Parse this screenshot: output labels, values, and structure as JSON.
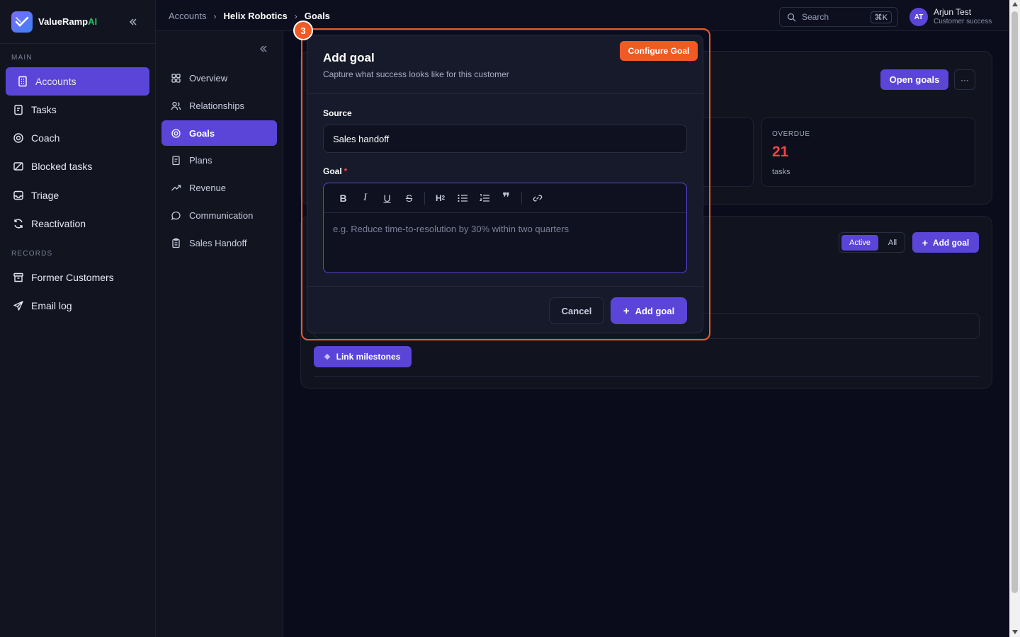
{
  "brand": {
    "name": "ValueRamp",
    "suffix": "AI"
  },
  "sidebar": {
    "main_label": "MAIN",
    "main_items": [
      {
        "label": "Accounts",
        "icon": "building-icon",
        "active": true
      },
      {
        "label": "Tasks",
        "icon": "clipboard-icon"
      },
      {
        "label": "Coach",
        "icon": "target-icon"
      },
      {
        "label": "Blocked tasks",
        "icon": "blocked-icon"
      },
      {
        "label": "Triage",
        "icon": "inbox-icon"
      },
      {
        "label": "Reactivation",
        "icon": "refresh-icon"
      }
    ],
    "records_label": "RECORDS",
    "records_items": [
      {
        "label": "Former Customers",
        "icon": "archive-icon"
      },
      {
        "label": "Email log",
        "icon": "send-icon"
      }
    ]
  },
  "subnav": {
    "items": [
      {
        "label": "Overview",
        "icon": "grid-icon"
      },
      {
        "label": "Relationships",
        "icon": "users-icon"
      },
      {
        "label": "Goals",
        "icon": "target-icon",
        "active": true
      },
      {
        "label": "Plans",
        "icon": "clipboard-icon"
      },
      {
        "label": "Revenue",
        "icon": "trend-up-icon"
      },
      {
        "label": "Communication",
        "icon": "chat-icon"
      },
      {
        "label": "Sales Handoff",
        "icon": "clipboard-list-icon"
      }
    ]
  },
  "breadcrumb": {
    "items": [
      "Accounts",
      "Helix Robotics",
      "Goals"
    ]
  },
  "search": {
    "placeholder": "Search",
    "shortcut": "⌘K"
  },
  "user": {
    "initials": "AT",
    "name": "Arjun Test",
    "role": "Customer success"
  },
  "header_card": {
    "open_goals_label": "Open goals",
    "more_label": "···"
  },
  "overdue": {
    "label": "OVERDUE",
    "value": "21",
    "unit": "tasks"
  },
  "goals_card": {
    "toggle_active": "Active",
    "toggle_all": "All",
    "add_goal_label": "Add goal",
    "link_milestones_label": "Link milestones"
  },
  "modal": {
    "step": "3",
    "configure_label": "Configure Goal",
    "title": "Add goal",
    "subtitle": "Capture what success looks like for this customer",
    "source_label": "Source",
    "source_value": "Sales handoff",
    "goal_label": "Goal",
    "goal_required": "*",
    "goal_placeholder": "e.g. Reduce time-to-resolution by 30% within two quarters",
    "cancel_label": "Cancel",
    "submit_label": "Add goal"
  },
  "colors": {
    "accent": "#5b45d8",
    "highlight": "#f15a24",
    "danger": "#ef4444",
    "brand_ai": "#22c55e"
  }
}
